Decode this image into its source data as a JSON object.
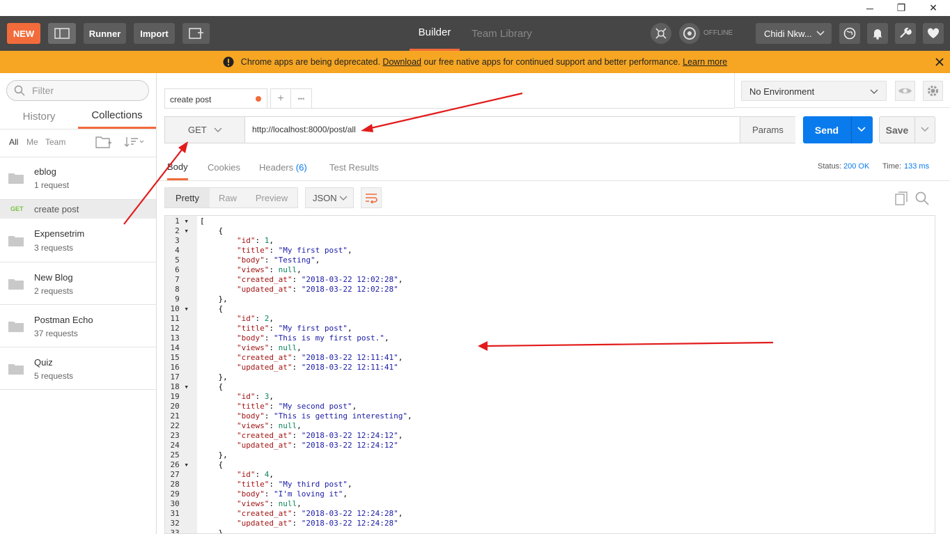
{
  "window": {
    "minimize": "─",
    "restore": "❐",
    "close": "✕"
  },
  "header": {
    "new_label": "NEW",
    "runner_label": "Runner",
    "import_label": "Import",
    "builder_label": "Builder",
    "team_library_label": "Team Library",
    "offline_label": "OFFLINE",
    "user_label": "Chidi Nkw..."
  },
  "banner": {
    "text_before": "Chrome apps are being deprecated.",
    "download_link": "Download",
    "text_middle": "our free native apps for continued support and better performance.",
    "learn_more_link": "Learn more"
  },
  "sidebar": {
    "filter_placeholder": "Filter",
    "tabs": {
      "history": "History",
      "collections": "Collections"
    },
    "filters": {
      "all": "All",
      "me": "Me",
      "team": "Team"
    },
    "collections": [
      {
        "name": "eblog",
        "count": "1 request"
      },
      {
        "name": "Expensetrim",
        "count": "3 requests"
      },
      {
        "name": "New Blog",
        "count": "2 requests"
      },
      {
        "name": "Postman Echo",
        "count": "37 requests"
      },
      {
        "name": "Quiz",
        "count": "5 requests"
      }
    ],
    "request": {
      "method": "GET",
      "name": "create post"
    }
  },
  "tabs": {
    "active_tab": "create post",
    "add": "+",
    "more": "•••"
  },
  "environment": {
    "selected": "No Environment"
  },
  "request": {
    "method": "GET",
    "url": "http://localhost:8000/post/all",
    "params_label": "Params",
    "send_label": "Send",
    "save_label": "Save"
  },
  "response": {
    "tabs": {
      "body": "Body",
      "cookies": "Cookies",
      "headers": "Headers",
      "headers_count": "(6)",
      "test_results": "Test Results"
    },
    "status_label": "Status:",
    "status_value": "200 OK",
    "time_label": "Time:",
    "time_value": "133 ms",
    "view_modes": {
      "pretty": "Pretty",
      "raw": "Raw",
      "preview": "Preview"
    },
    "format": "JSON"
  },
  "colors": {
    "accent": "#f26b3a",
    "send": "#097bed",
    "banner": "#f6a623",
    "header": "#464646",
    "arrow": "#e21b1b"
  },
  "code_lines": [
    "[",
    "    {",
    "        \"id\": 1,",
    "        \"title\": \"My first post\",",
    "        \"body\": \"Testing\",",
    "        \"views\": null,",
    "        \"created_at\": \"2018-03-22 12:02:28\",",
    "        \"updated_at\": \"2018-03-22 12:02:28\"",
    "    },",
    "    {",
    "        \"id\": 2,",
    "        \"title\": \"My first post\",",
    "        \"body\": \"This is my first post.\",",
    "        \"views\": null,",
    "        \"created_at\": \"2018-03-22 12:11:41\",",
    "        \"updated_at\": \"2018-03-22 12:11:41\"",
    "    },",
    "    {",
    "        \"id\": 3,",
    "        \"title\": \"My second post\",",
    "        \"body\": \"This is getting interesting\",",
    "        \"views\": null,",
    "        \"created_at\": \"2018-03-22 12:24:12\",",
    "        \"updated_at\": \"2018-03-22 12:24:12\"",
    "    },",
    "    {",
    "        \"id\": 4,",
    "        \"title\": \"My third post\",",
    "        \"body\": \"I'm loving it\",",
    "        \"views\": null,",
    "        \"created_at\": \"2018-03-22 12:24:28\",",
    "        \"updated_at\": \"2018-03-22 12:24:28\"",
    "    },"
  ]
}
